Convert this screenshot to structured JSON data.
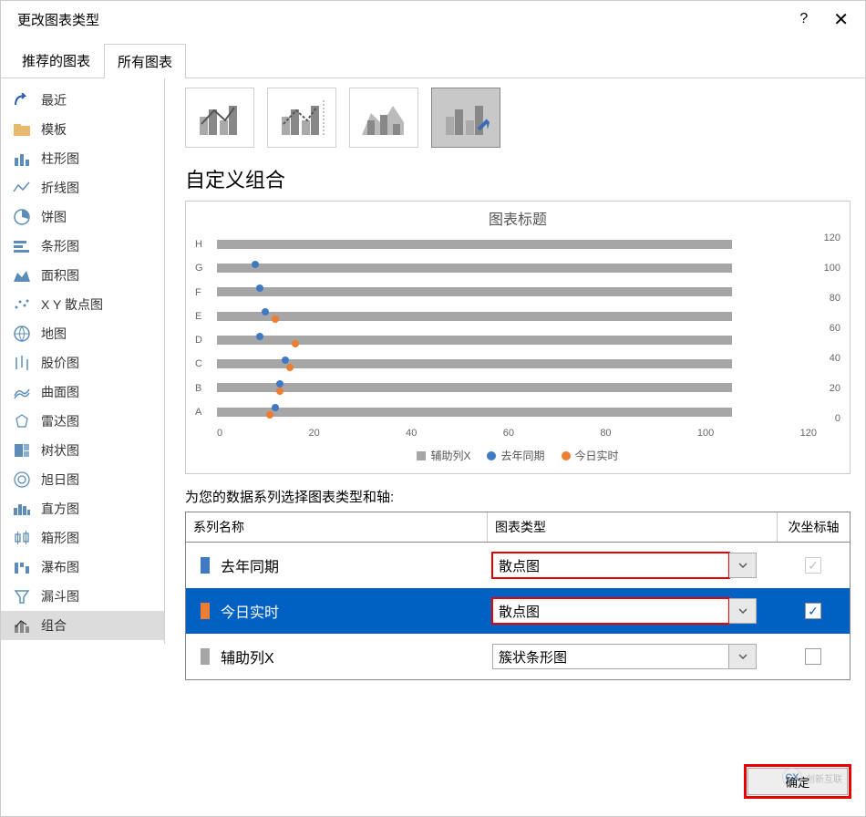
{
  "title": "更改图表类型",
  "tabs": {
    "recommended": "推荐的图表",
    "all": "所有图表"
  },
  "sidebar": {
    "recent": "最近",
    "templates": "模板",
    "column": "柱形图",
    "line": "折线图",
    "pie": "饼图",
    "bar": "条形图",
    "area": "面积图",
    "scatter": "X Y 散点图",
    "map": "地图",
    "stock": "股价图",
    "surface": "曲面图",
    "radar": "雷达图",
    "treemap": "树状图",
    "sunburst": "旭日图",
    "histogram": "直方图",
    "boxwhisker": "箱形图",
    "waterfall": "瀑布图",
    "funnel": "漏斗图",
    "combo": "组合"
  },
  "section_title": "自定义组合",
  "chart_title": "图表标题",
  "chart_data": {
    "type": "combo",
    "categories": [
      "A",
      "B",
      "C",
      "D",
      "E",
      "F",
      "G",
      "H"
    ],
    "series": [
      {
        "name": "辅助列X",
        "type": "bar",
        "values": [
          104,
          104,
          104,
          104,
          104,
          104,
          104,
          104
        ]
      },
      {
        "name": "去年同期",
        "type": "scatter",
        "values": [
          11,
          12,
          13,
          8,
          9,
          8,
          7,
          null
        ]
      },
      {
        "name": "今日实时",
        "type": "scatter",
        "values": [
          10,
          12,
          14,
          15,
          11,
          null,
          null,
          null
        ]
      }
    ],
    "xticks": [
      0,
      20,
      40,
      60,
      80,
      100,
      120
    ],
    "y2ticks": [
      0,
      20,
      40,
      60,
      80,
      100,
      120
    ],
    "legend": [
      "辅助列X",
      "去年同期",
      "今日实时"
    ]
  },
  "instruction": "为您的数据系列选择图表类型和轴:",
  "table": {
    "hdr_name": "系列名称",
    "hdr_type": "图表类型",
    "hdr_axis": "次坐标轴",
    "rows": [
      {
        "name": "去年同期",
        "type": "散点图",
        "axis_checked": true,
        "color": "#3f79c1",
        "selected": false,
        "highlight_type": true,
        "disabled_axis": true
      },
      {
        "name": "今日实时",
        "type": "散点图",
        "axis_checked": true,
        "color": "#ed7d31",
        "selected": true,
        "highlight_type": true
      },
      {
        "name": "辅助列X",
        "type": "簇状条形图",
        "axis_checked": false,
        "color": "#a6a6a6",
        "selected": false
      }
    ]
  },
  "buttons": {
    "ok": "确定"
  },
  "watermark": "创新互联"
}
